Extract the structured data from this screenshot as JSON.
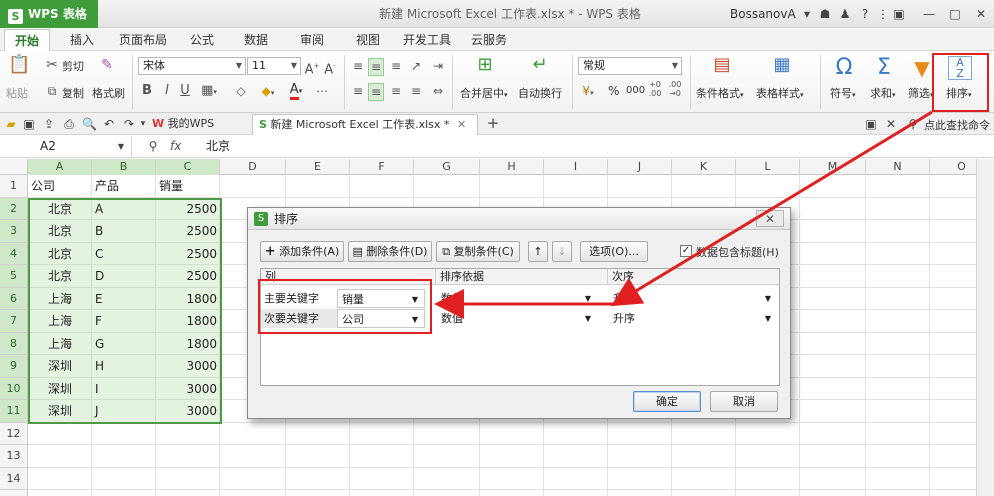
{
  "titlebar": {
    "app_button": "WPS 表格",
    "document_title": "新建 Microsoft Excel 工作表.xlsx * - WPS 表格",
    "user_name": "BossanovA"
  },
  "menu": {
    "tabs": [
      "开始",
      "插入",
      "页面布局",
      "公式",
      "数据",
      "审阅",
      "视图",
      "开发工具",
      "云服务"
    ]
  },
  "ribbon": {
    "cut": "剪切",
    "copy": "复制",
    "paste": "粘贴",
    "format_painter": "格式刷",
    "font_name": "宋体",
    "font_size": "11",
    "merge_center": "合并居中",
    "wrap_text": "自动换行",
    "number_format": "常规",
    "conditional_format": "条件格式",
    "table_style": "表格样式",
    "symbol": "符号",
    "sum": "求和",
    "filter": "筛选",
    "sort": "排序",
    "percent": "%",
    "thousands": "000"
  },
  "doc_tabs": {
    "my_wps": "我的WPS",
    "active": "新建 Microsoft Excel 工作表.xlsx *",
    "search_hint": "点此查找命令"
  },
  "formula_bar": {
    "cell_ref": "A2",
    "fx": "fx",
    "content": "北京"
  },
  "sheet": {
    "columns": [
      "A",
      "B",
      "C",
      "D",
      "E",
      "F",
      "G",
      "H",
      "I",
      "J",
      "K",
      "L",
      "M",
      "N",
      "O"
    ],
    "row_numbers": [
      "1",
      "2",
      "3",
      "4",
      "5",
      "6",
      "7",
      "8",
      "9",
      "10",
      "11",
      "12",
      "13",
      "14",
      "15"
    ],
    "header_row": [
      "公司",
      "产品",
      "销量"
    ],
    "rows": [
      [
        "北京",
        "A",
        "2500"
      ],
      [
        "北京",
        "B",
        "2500"
      ],
      [
        "北京",
        "C",
        "2500"
      ],
      [
        "北京",
        "D",
        "2500"
      ],
      [
        "上海",
        "E",
        "1800"
      ],
      [
        "上海",
        "F",
        "1800"
      ],
      [
        "上海",
        "G",
        "1800"
      ],
      [
        "深圳",
        "H",
        "3000"
      ],
      [
        "深圳",
        "I",
        "3000"
      ],
      [
        "深圳",
        "J",
        "3000"
      ]
    ]
  },
  "dialog": {
    "title": "排序",
    "add_condition": "添加条件(A)",
    "delete_condition": "删除条件(D)",
    "copy_condition": "复制条件(C)",
    "options": "选项(O)...",
    "has_header": "数据包含标题(H)",
    "col_header": "列",
    "basis_header": "排序依据",
    "order_header": "次序",
    "conditions": [
      {
        "label": "主要关键字",
        "column": "销量",
        "basis": "数值",
        "order": "升序"
      },
      {
        "label": "次要关键字",
        "column": "公司",
        "basis": "数值",
        "order": "升序"
      }
    ],
    "ok": "确定",
    "cancel": "取消"
  }
}
